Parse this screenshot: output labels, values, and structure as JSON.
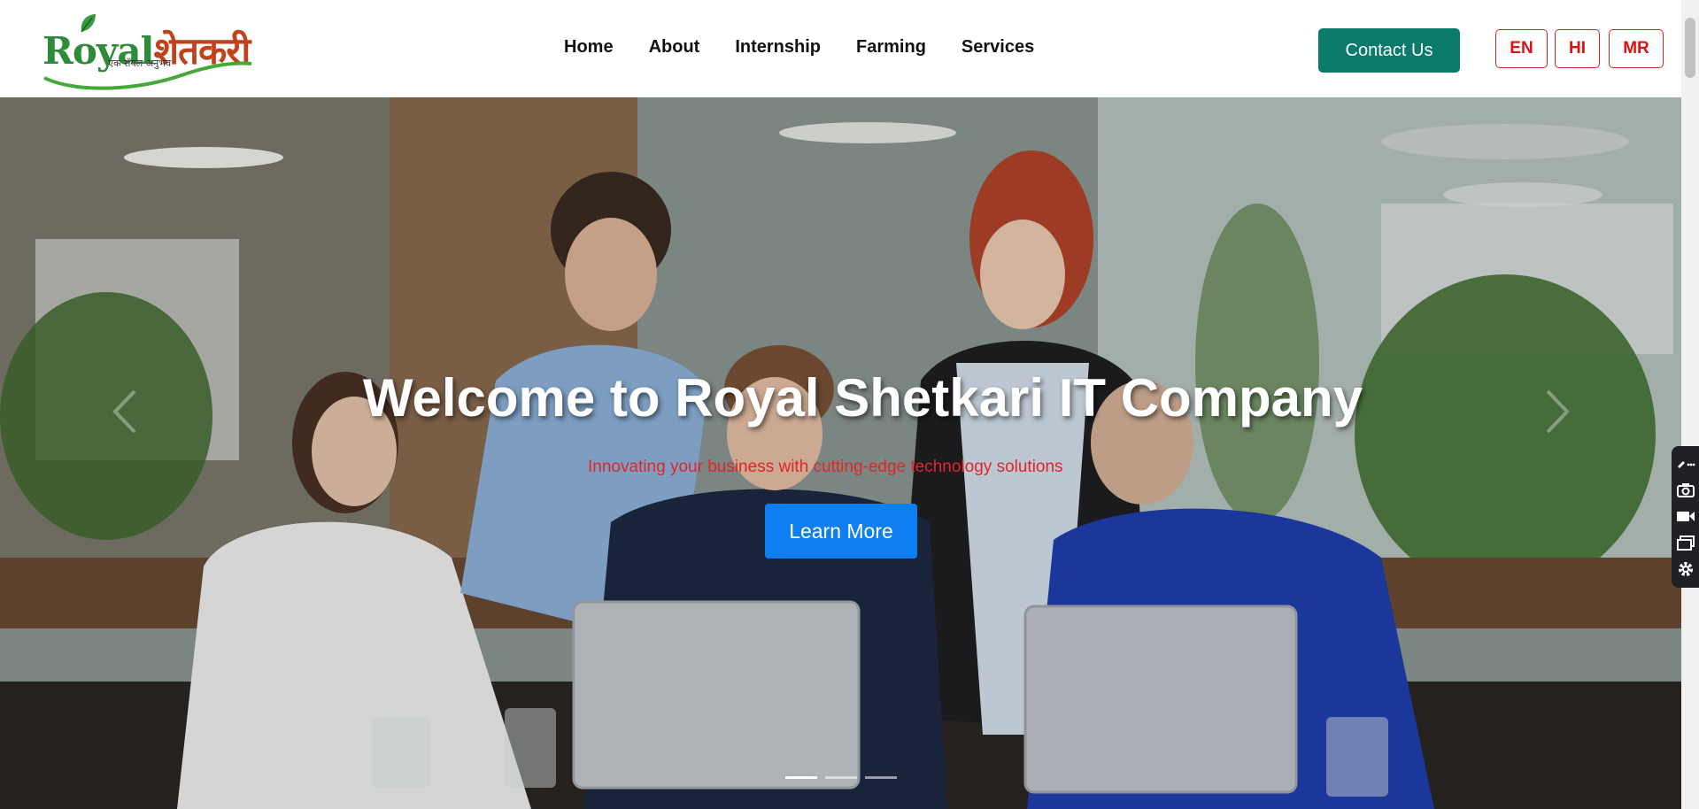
{
  "logo": {
    "brand_latin": "Royal",
    "brand_devanagari": "शेतकरी",
    "tagline": "एक रॉयल अनुभव"
  },
  "nav": [
    "Home",
    "About",
    "Internship",
    "Farming",
    "Services"
  ],
  "header": {
    "contact_label": "Contact Us",
    "languages": [
      "EN",
      "HI",
      "MR"
    ]
  },
  "hero": {
    "title": "Welcome to Royal Shetkari IT Company",
    "subtitle": "Innovating your business with cutting-edge technology solutions",
    "cta_label": "Learn More",
    "slide_count": 3,
    "active_slide": 1
  },
  "toolbar_icons": [
    "edit-more-icon",
    "camera-icon",
    "video-icon",
    "window-icon",
    "settings-icon"
  ],
  "colors": {
    "contact_bg": "#0a7a6a",
    "lang_border": "#c62828",
    "cta_bg": "#0d7ff2",
    "subtitle": "#e0262a",
    "brand_green": "#2e8b3a",
    "brand_orange": "#c0421c"
  }
}
